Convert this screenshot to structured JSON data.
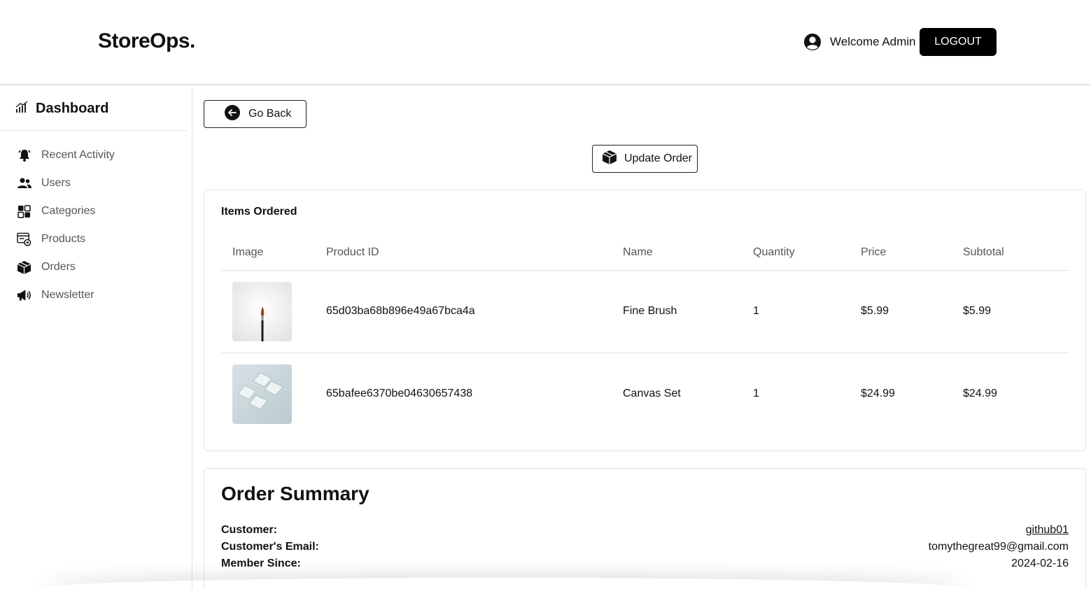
{
  "header": {
    "brand": "StoreOps.",
    "welcome": "Welcome Admin",
    "logout_label": "LOGOUT",
    "user_icon": "user-circle-icon"
  },
  "sidebar": {
    "title": "Dashboard",
    "title_icon": "chart-bars-icon",
    "items": [
      {
        "label": "Recent Activity",
        "icon": "bell-icon"
      },
      {
        "label": "Users",
        "icon": "users-icon"
      },
      {
        "label": "Categories",
        "icon": "categories-icon"
      },
      {
        "label": "Products",
        "icon": "products-icon"
      },
      {
        "label": "Orders",
        "icon": "box-icon"
      },
      {
        "label": "Newsletter",
        "icon": "megaphone-icon"
      }
    ]
  },
  "actions": {
    "go_back_label": "Go Back",
    "update_order_label": "Update Order"
  },
  "items_ordered": {
    "title": "Items Ordered",
    "columns": [
      "Image",
      "Product ID",
      "Name",
      "Quantity",
      "Price",
      "Subtotal"
    ],
    "rows": [
      {
        "image": "fine-brush-image",
        "product_id": "65d03ba68b896e49a67bca4a",
        "name": "Fine Brush",
        "quantity": "1",
        "price": "$5.99",
        "subtotal": "$5.99"
      },
      {
        "image": "canvas-set-image",
        "product_id": "65bafee6370be04630657438",
        "name": "Canvas Set",
        "quantity": "1",
        "price": "$24.99",
        "subtotal": "$24.99"
      }
    ]
  },
  "order_summary": {
    "title": "Order Summary",
    "customer_label": "Customer:",
    "customer_value": "github01",
    "email_label": "Customer's Email:",
    "email_value": "tomythegreat99@gmail.com",
    "member_since_label": "Member Since:",
    "member_since_value": "2024-02-16"
  },
  "colors": {
    "primary": "#000000",
    "text": "#111111",
    "muted": "#555555",
    "border": "#e3e3e3"
  }
}
